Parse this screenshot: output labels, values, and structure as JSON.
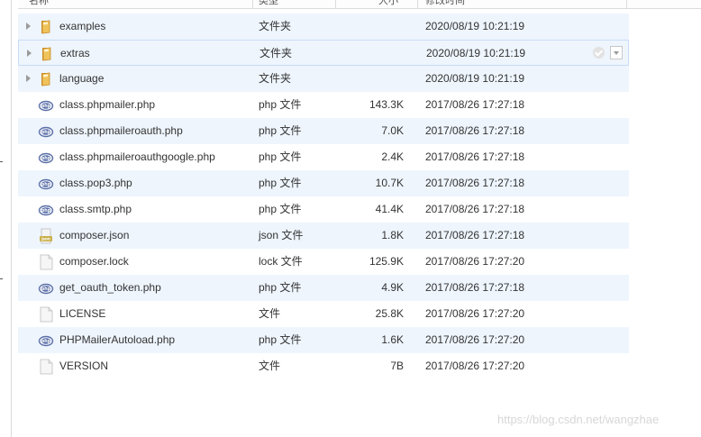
{
  "header": {
    "col_name": "名称",
    "col_type": "类型",
    "col_size": "大小",
    "col_date": "修改时间"
  },
  "rows": [
    {
      "name": "examples",
      "type": "文件夹",
      "size": "",
      "date": "2020/08/19 10:21:19",
      "icon": "folder-icon",
      "folder": true
    },
    {
      "name": "extras",
      "type": "文件夹",
      "size": "",
      "date": "2020/08/19 10:21:19",
      "icon": "folder-icon",
      "folder": true
    },
    {
      "name": "language",
      "type": "文件夹",
      "size": "",
      "date": "2020/08/19 10:21:19",
      "icon": "folder-icon",
      "folder": true
    },
    {
      "name": "class.phpmailer.php",
      "type": "php 文件",
      "size": "143.3K",
      "date": "2017/08/26 17:27:18",
      "icon": "php-file-icon"
    },
    {
      "name": "class.phpmaileroauth.php",
      "type": "php 文件",
      "size": "7.0K",
      "date": "2017/08/26 17:27:18",
      "icon": "php-file-icon"
    },
    {
      "name": "class.phpmaileroauthgoogle.php",
      "type": "php 文件",
      "size": "2.4K",
      "date": "2017/08/26 17:27:18",
      "icon": "php-file-icon"
    },
    {
      "name": "class.pop3.php",
      "type": "php 文件",
      "size": "10.7K",
      "date": "2017/08/26 17:27:18",
      "icon": "php-file-icon"
    },
    {
      "name": "class.smtp.php",
      "type": "php 文件",
      "size": "41.4K",
      "date": "2017/08/26 17:27:18",
      "icon": "php-file-icon"
    },
    {
      "name": "composer.json",
      "type": "json 文件",
      "size": "1.8K",
      "date": "2017/08/26 17:27:18",
      "icon": "json-file-icon"
    },
    {
      "name": "composer.lock",
      "type": "lock 文件",
      "size": "125.9K",
      "date": "2017/08/26 17:27:20",
      "icon": "blank-file-icon"
    },
    {
      "name": "get_oauth_token.php",
      "type": "php 文件",
      "size": "4.9K",
      "date": "2017/08/26 17:27:18",
      "icon": "php-file-icon"
    },
    {
      "name": "LICENSE",
      "type": "文件",
      "size": "25.8K",
      "date": "2017/08/26 17:27:20",
      "icon": "blank-file-icon"
    },
    {
      "name": "PHPMailerAutoload.php",
      "type": "php 文件",
      "size": "1.6K",
      "date": "2017/08/26 17:27:20",
      "icon": "php-file-icon"
    },
    {
      "name": "VERSION",
      "type": "文件",
      "size": "7B",
      "date": "2017/08/26 17:27:20",
      "icon": "blank-file-icon"
    }
  ],
  "hover_row": 1,
  "watermark": "https://blog.csdn.net/wangzhae",
  "colors": {
    "row_alt": "#eef5fd",
    "row_hover_border": "#c7dcf5",
    "folder": "#e8b14a",
    "php_badge": "#5a6fa8"
  }
}
